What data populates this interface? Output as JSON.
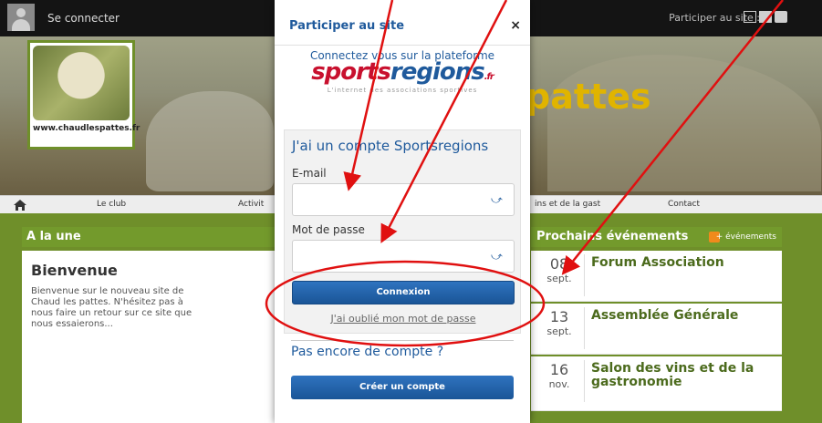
{
  "topbar": {
    "login_label": "Se connecter",
    "participate_label": "Participer au site :",
    "icons": [
      "edit-icon",
      "photo-icon",
      "video-icon"
    ]
  },
  "banner": {
    "logo_text": "www.chaudlespattes.fr",
    "site_title": "pattes"
  },
  "nav": {
    "items": [
      "Le club",
      "Activit",
      "ins et de la gast",
      "Contact"
    ]
  },
  "main": {
    "section_title": "A la une",
    "article": {
      "title": "Bienvenue",
      "body": "Bienvenue sur le nouveau site de Chaud les pattes. N'hésitez pas à nous faire un retour sur ce site que nous essaierons..."
    }
  },
  "sidebar": {
    "title": "Prochains événements",
    "add_label": "+ événements",
    "events": [
      {
        "day": "08",
        "month": "sept.",
        "title": "Forum Association"
      },
      {
        "day": "13",
        "month": "sept.",
        "title": "Assemblée Générale"
      },
      {
        "day": "16",
        "month": "nov.",
        "title": "Salon des vins et de la gastronomie"
      }
    ]
  },
  "modal": {
    "title": "Participer au site",
    "close_label": "×",
    "connect_text": "Connectez vous sur la plateforme",
    "brand_red": "sports",
    "brand_blue": "regions",
    "brand_suffix": ".fr",
    "tagline": "L'internet des associations sportives",
    "panel_title": "J'ai un compte Sportsregions",
    "email_label": "E-mail",
    "email_value": "",
    "password_label": "Mot de passe",
    "password_value": "",
    "login_button": "Connexion",
    "forgot_link": "J'ai oublié mon mot de passe",
    "no_account": "Pas encore de compte ?",
    "create_button": "Créer un compte"
  },
  "colors": {
    "accent_green": "#739a2c",
    "brand_blue": "#1f5a9c",
    "brand_red": "#c8102e",
    "annotation_red": "#e01010"
  }
}
